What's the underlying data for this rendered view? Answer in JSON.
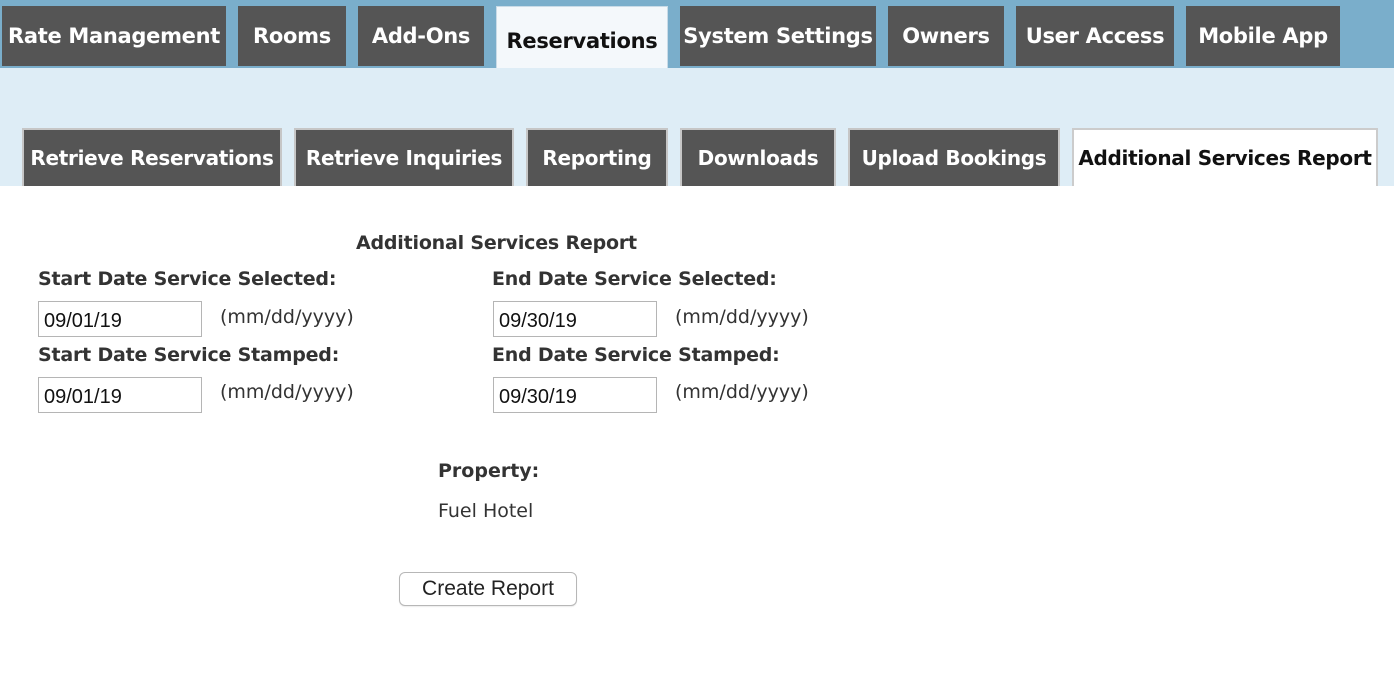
{
  "top_nav": {
    "tabs": [
      {
        "label": "Rate Management",
        "active": false
      },
      {
        "label": "Rooms",
        "active": false
      },
      {
        "label": "Add-Ons",
        "active": false
      },
      {
        "label": "Reservations",
        "active": true
      },
      {
        "label": "System Settings",
        "active": false
      },
      {
        "label": "Owners",
        "active": false
      },
      {
        "label": "User Access",
        "active": false
      },
      {
        "label": "Mobile App",
        "active": false
      }
    ]
  },
  "sub_nav": {
    "tabs": [
      {
        "label": "Retrieve Reservations",
        "active": false
      },
      {
        "label": "Retrieve Inquiries",
        "active": false
      },
      {
        "label": "Reporting",
        "active": false
      },
      {
        "label": "Downloads",
        "active": false
      },
      {
        "label": "Upload Bookings",
        "active": false
      },
      {
        "label": "Additional Services Report",
        "active": true
      }
    ]
  },
  "form": {
    "title": "Additional Services Report",
    "start_selected": {
      "label": "Start Date Service Selected:",
      "value": "09/01/19",
      "hint": "(mm/dd/yyyy)"
    },
    "end_selected": {
      "label": "End Date Service Selected:",
      "value": "09/30/19",
      "hint": "(mm/dd/yyyy)"
    },
    "start_stamped": {
      "label": "Start Date Service Stamped:",
      "value": "09/01/19",
      "hint": "(mm/dd/yyyy)"
    },
    "end_stamped": {
      "label": "End Date Service Stamped:",
      "value": "09/30/19",
      "hint": "(mm/dd/yyyy)"
    },
    "property_label": "Property:",
    "property_value": "Fuel Hotel",
    "submit_label": "Create Report"
  },
  "colors": {
    "top_band": "#7aaecb",
    "sub_band": "#deedf6",
    "tab_dark": "#555555",
    "tab_active": "#ffffff"
  }
}
